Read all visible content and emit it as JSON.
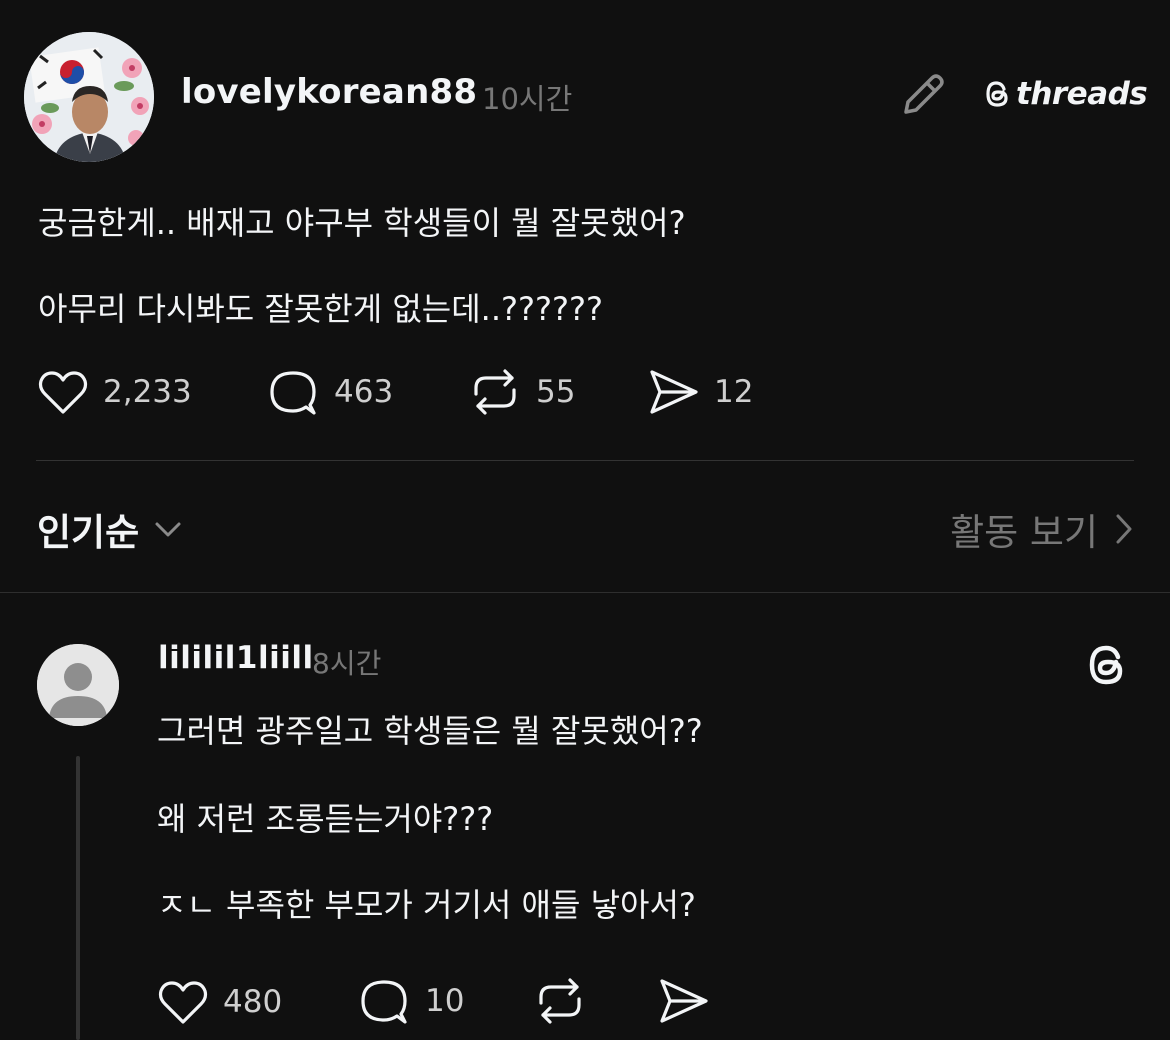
{
  "post": {
    "username": "lovelykorean88",
    "time": "10시간",
    "brand": "threads",
    "text_lines": [
      "궁금한게.. 배재고 야구부 학생들이 뭘 잘못했어?",
      "아무리 다시봐도 잘못한게 없는데..??????"
    ],
    "stats": {
      "likes": "2,233",
      "comments": "463",
      "reposts": "55",
      "shares": "12"
    }
  },
  "sort": {
    "label": "인기순",
    "activity_label": "활동 보기"
  },
  "reply": {
    "username": "lililil1liill",
    "time": "8시간",
    "text_lines": [
      "그러면 광주일고 학생들은 뭘 잘못했어??",
      "왜 저런 조롱듣는거야???",
      "ㅈㄴ 부족한 부모가 거기서 애들 낳아서?"
    ],
    "stats": {
      "likes": "480",
      "comments": "10"
    }
  },
  "icons": {
    "edit": "pencil-icon",
    "like": "heart-icon",
    "comment": "comment-icon",
    "repost": "repost-icon",
    "share": "send-icon",
    "sort_chevron": "chevron-down-icon",
    "activity_chevron": "chevron-right-icon",
    "threads": "threads-logo-icon"
  },
  "colors": {
    "background": "#101010",
    "text": "#f3f5f7",
    "muted": "#777777",
    "divider": "#333333"
  }
}
